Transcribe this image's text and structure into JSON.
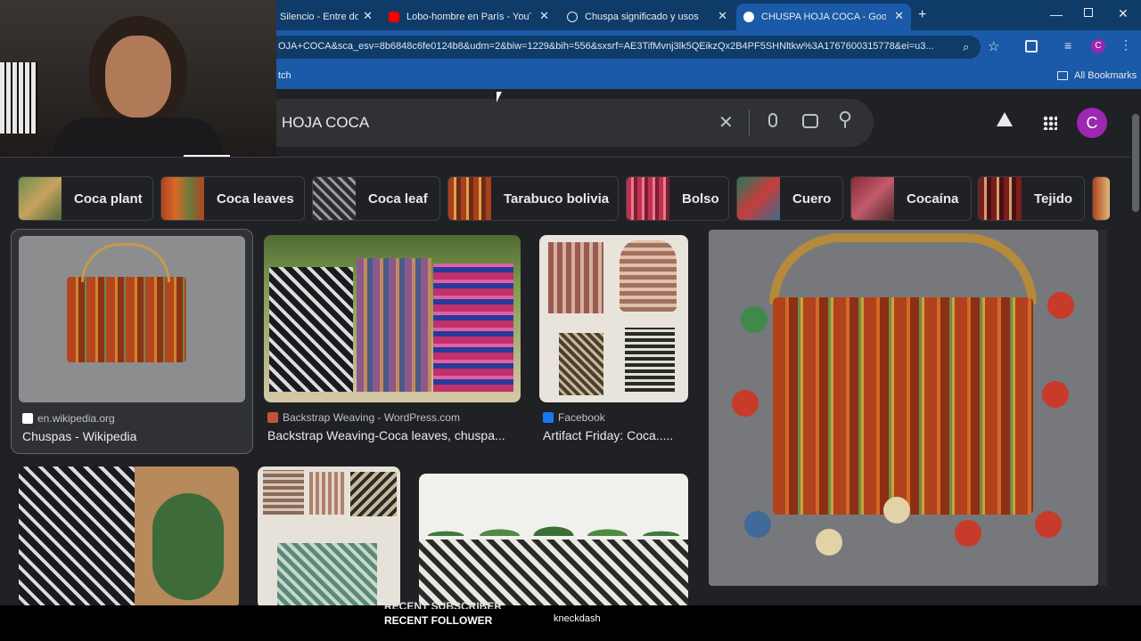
{
  "tabs": [
    {
      "label": "Silencio - Entre dos"
    },
    {
      "label": "Lobo-hombre en París - YouTube"
    },
    {
      "label": "Chuspa significado y usos"
    },
    {
      "label": "CHUSPA HOJA COCA - Google"
    }
  ],
  "omnibox": {
    "url": "OJA+COCA&sca_esv=8b6848c6fe0124b8&udm=2&biw=1229&bih=556&sxsrf=AE3TifMvnj3lk5QEikzQx2B4PF5SHNltkw%3A1767600315778&ei=u3..."
  },
  "bookmarks": {
    "partial": "tch",
    "all_label": "All Bookmarks"
  },
  "search": {
    "query": "HOJA COCA",
    "avatar_letter": "C"
  },
  "chips": [
    {
      "label": "Coca plant"
    },
    {
      "label": "Coca leaves"
    },
    {
      "label": "Coca leaf"
    },
    {
      "label": "Tarabuco bolivia"
    },
    {
      "label": "Bolso"
    },
    {
      "label": "Cuero"
    },
    {
      "label": "Cocaína"
    },
    {
      "label": "Tejido"
    }
  ],
  "results": [
    {
      "source": "en.wikipedia.org",
      "title": "Chuspas - Wikipedia"
    },
    {
      "source": "Backstrap Weaving - WordPress.com",
      "title": "Backstrap Weaving-Coca leaves, chuspa..."
    },
    {
      "source": "Facebook",
      "title": "Artifact Friday: Coca....."
    }
  ],
  "overlay": {
    "line1": "RECENT SUBSCRIBER",
    "line2": "RECENT FOLLOWER",
    "name": "kneckdash"
  },
  "colors": {
    "tabbar": "#0f3b69",
    "toolbar": "#1a5aa8",
    "page_bg": "#202124",
    "avatar": "#9c27b0"
  }
}
